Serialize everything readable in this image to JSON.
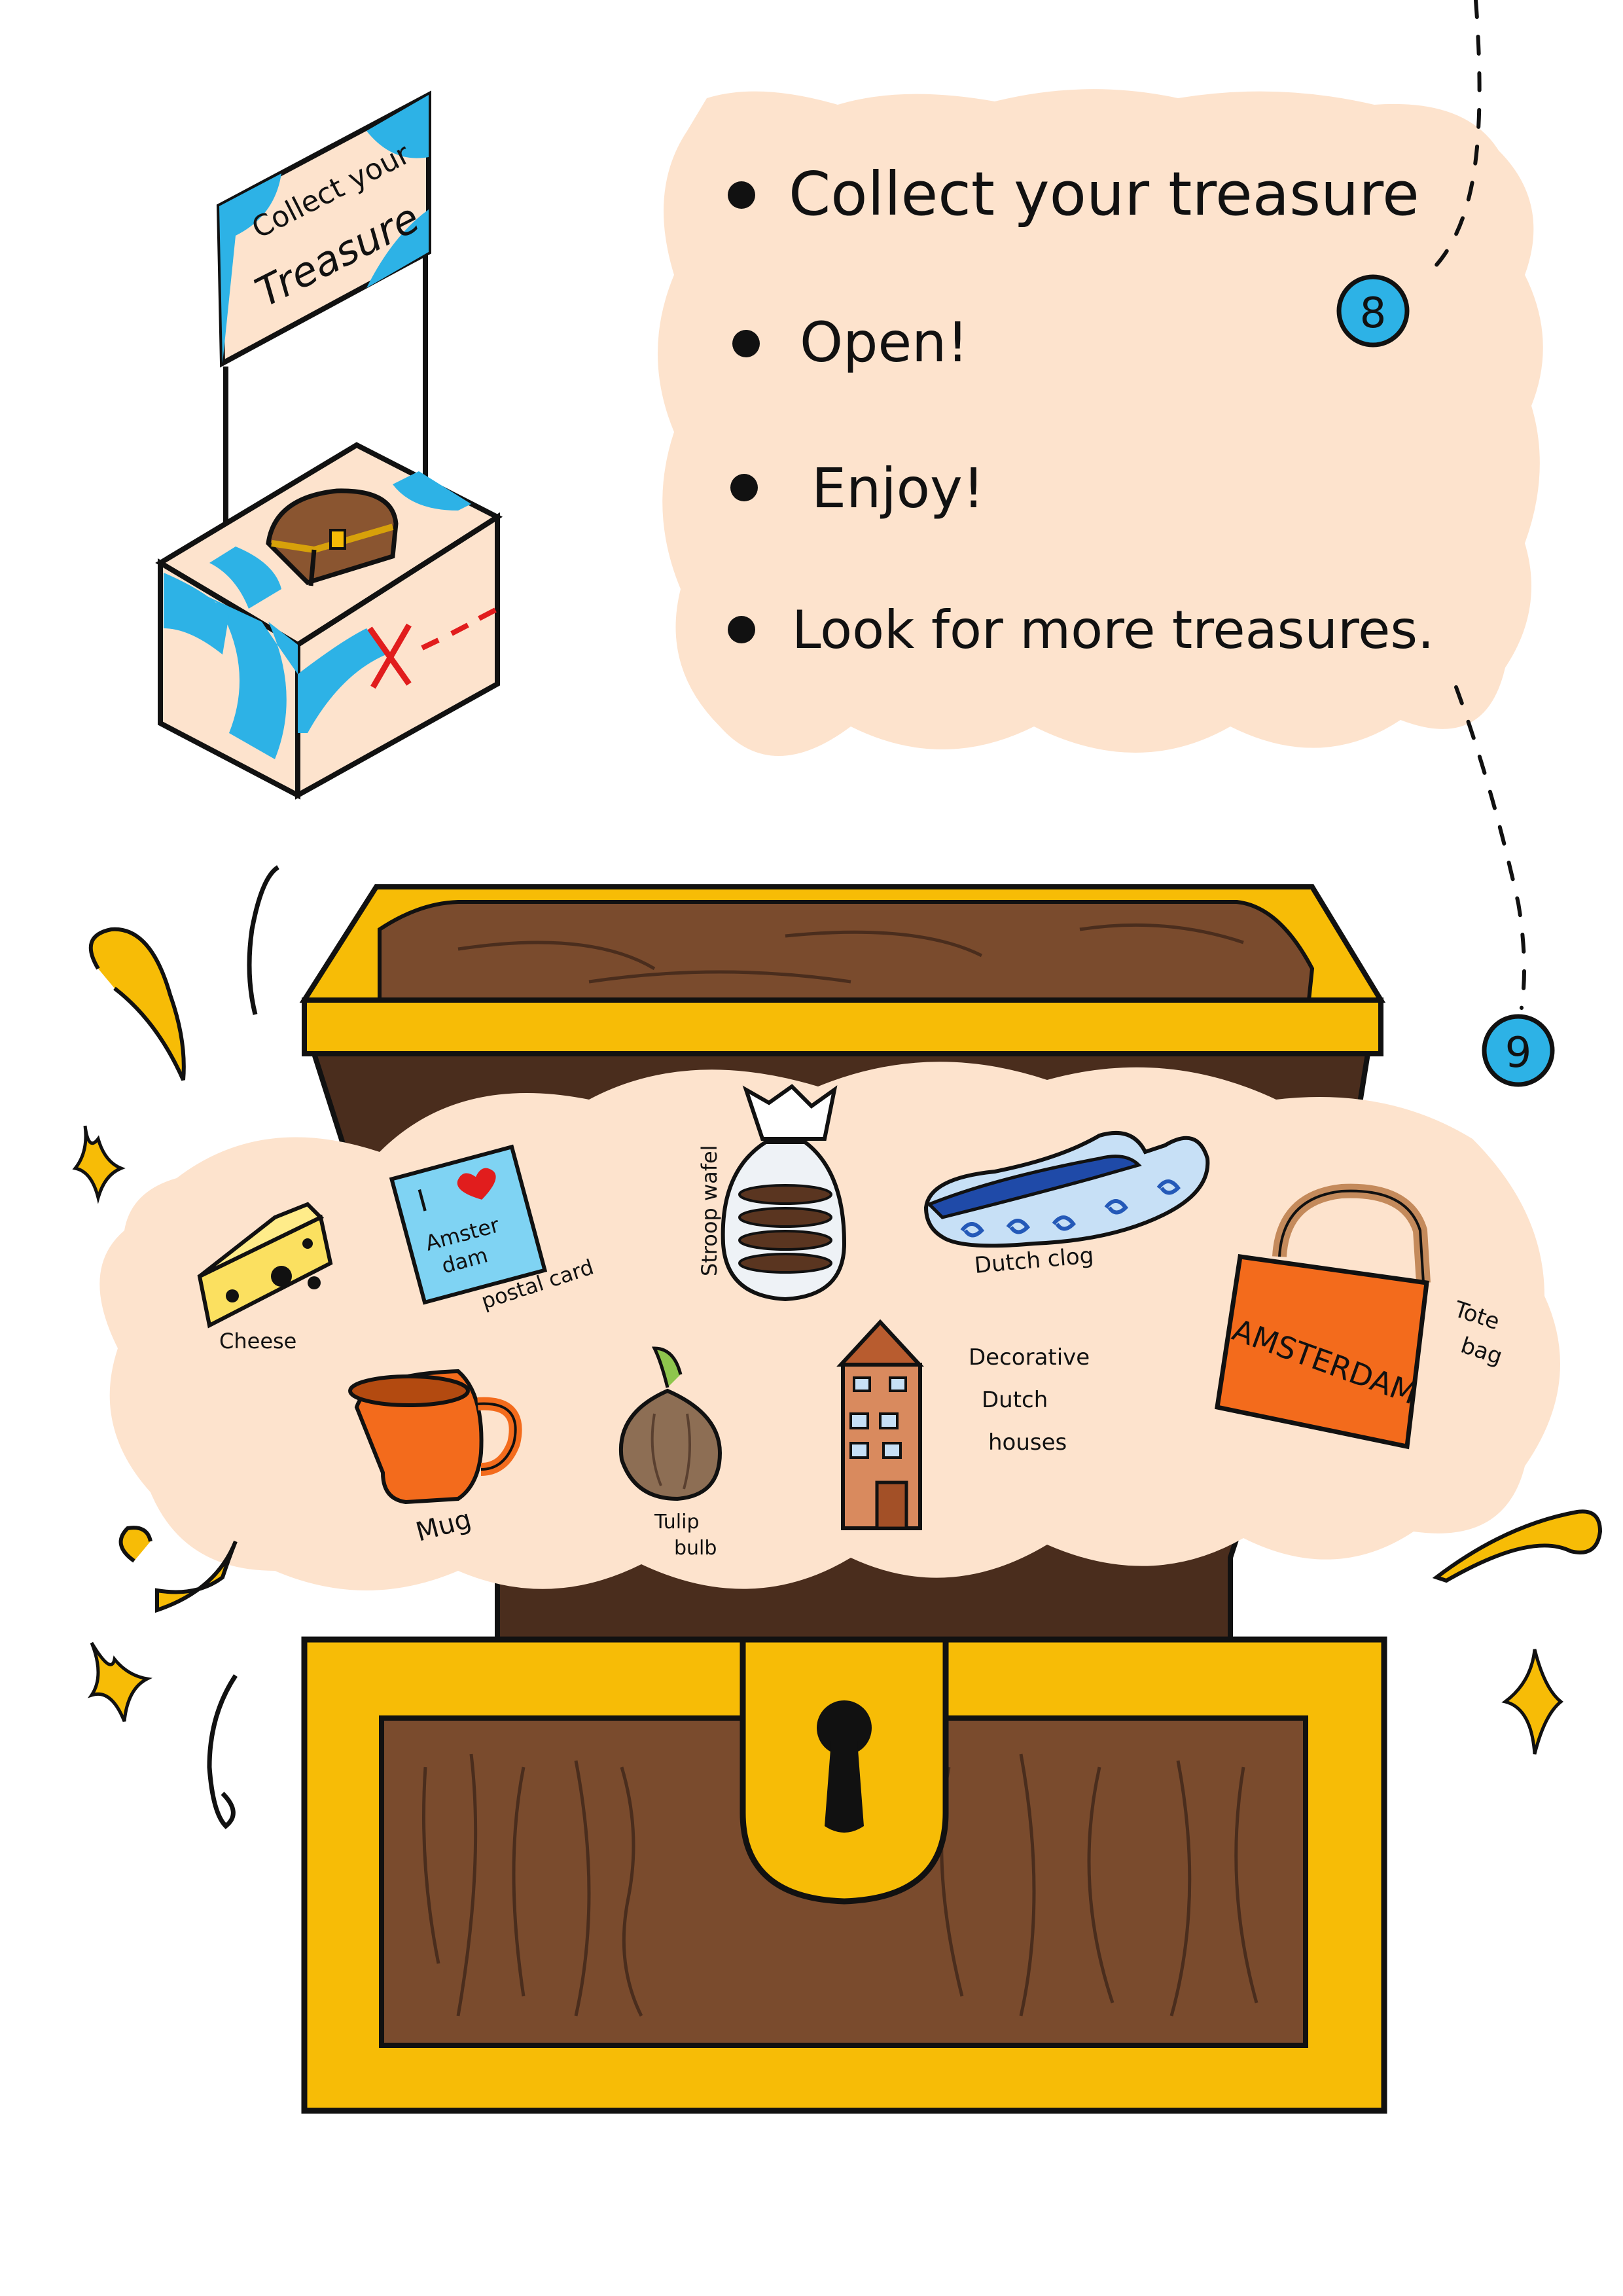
{
  "stand": {
    "sign_line1": "Collect your",
    "sign_line2": "Treasure",
    "map_mark": "X---"
  },
  "steps": [
    {
      "text": "Collect your treasure"
    },
    {
      "text": "Open!"
    },
    {
      "text": "Enjoy!"
    },
    {
      "text": "Look for more treasures."
    }
  ],
  "markers": {
    "step8": "8",
    "step9": "9"
  },
  "items": {
    "cheese": "Cheese",
    "postal_card": "postal card",
    "postal_card_line1": "I",
    "postal_card_line2": "Amster",
    "postal_card_line3": "dam",
    "stroopwafel": "Stroop wafel",
    "clog": "Dutch clog",
    "tote_label_1": "Tote",
    "tote_label_2": "bag",
    "tote_print": "AMSTERDAM",
    "mug": "Mug",
    "tulip_1": "Tulip",
    "tulip_2": "bulb",
    "houses_1": "Decorative",
    "houses_2": "Dutch",
    "houses_3": "houses"
  },
  "colors": {
    "peach": "#fde3cd",
    "gold": "#f7bc06",
    "wood": "#7a4b2d",
    "wood_dark": "#4a2d1d",
    "sky": "#2db2e6",
    "orange": "#f36b1c",
    "red": "#e11d1d"
  }
}
